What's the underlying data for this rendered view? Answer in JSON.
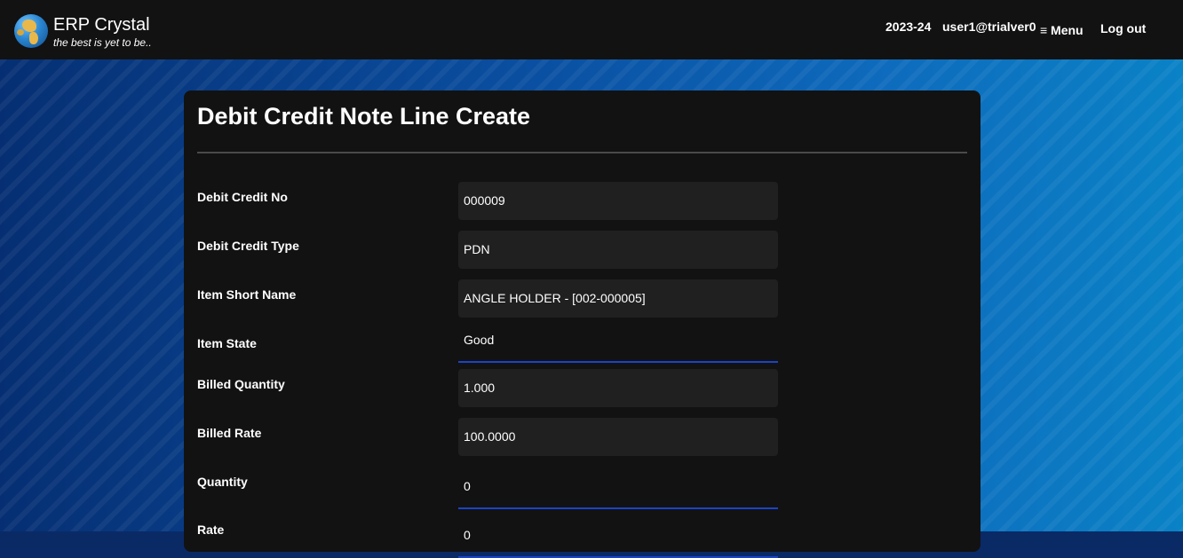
{
  "header": {
    "brand": "ERP Crystal",
    "tagline": "the best is yet to be..",
    "year": "2023-24",
    "user": "user1@trialver0",
    "menu_label": "≡ Menu",
    "logout_label": "Log out"
  },
  "form": {
    "title": "Debit Credit Note Line Create",
    "fields": [
      {
        "label": "Debit Credit No",
        "value": "000009"
      },
      {
        "label": "Debit Credit Type",
        "value": "PDN"
      },
      {
        "label": "Item Short Name",
        "value": "ANGLE HOLDER - [002-000005]"
      },
      {
        "label": "Item State",
        "value": "Good"
      },
      {
        "label": "Billed Quantity",
        "value": "1.000"
      },
      {
        "label": "Billed Rate",
        "value": "100.0000"
      },
      {
        "label": "Quantity",
        "value": "0"
      },
      {
        "label": "Rate",
        "value": "0"
      }
    ]
  },
  "colors": {
    "topbar": "#121212",
    "card": "#121212",
    "field_bg": "#202020",
    "accent_underline": "#1a44c8"
  }
}
